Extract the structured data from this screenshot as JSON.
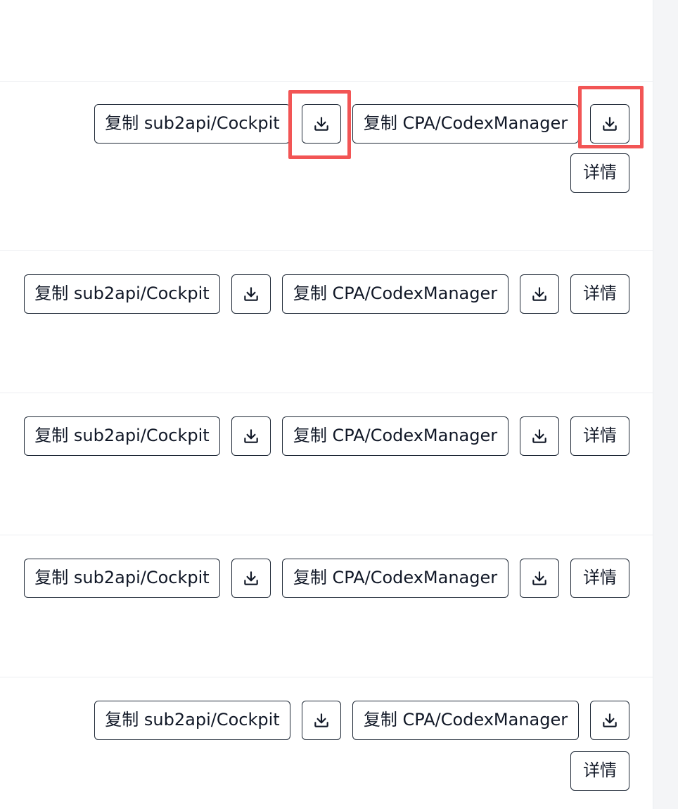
{
  "rows": [
    {
      "copy_sub2api_label": "复制 sub2api/Cockpit",
      "copy_cpa_label": "复制 CPA/CodexManager",
      "download_icon_1": "download-icon",
      "download_icon_2": "download-icon",
      "detail_label": "详情"
    },
    {
      "copy_sub2api_label": "复制 sub2api/Cockpit",
      "copy_cpa_label": "复制 CPA/CodexManager",
      "download_icon_1": "download-icon",
      "download_icon_2": "download-icon",
      "detail_label": "详情"
    },
    {
      "copy_sub2api_label": "复制 sub2api/Cockpit",
      "copy_cpa_label": "复制 CPA/CodexManager",
      "download_icon_1": "download-icon",
      "download_icon_2": "download-icon",
      "detail_label": "详情"
    },
    {
      "copy_sub2api_label": "复制 sub2api/Cockpit",
      "copy_cpa_label": "复制 CPA/CodexManager",
      "download_icon_1": "download-icon",
      "download_icon_2": "download-icon",
      "detail_label": "详情"
    },
    {
      "copy_sub2api_label": "复制 sub2api/Cockpit",
      "copy_cpa_label": "复制 CPA/CodexManager",
      "download_icon_1": "download-icon",
      "download_icon_2": "download-icon",
      "detail_label": "详情"
    }
  ],
  "colors": {
    "button_border": "#1f2937",
    "highlight": "#f25555",
    "divider": "#eceef1",
    "scroll_track": "#f4f5f7"
  }
}
